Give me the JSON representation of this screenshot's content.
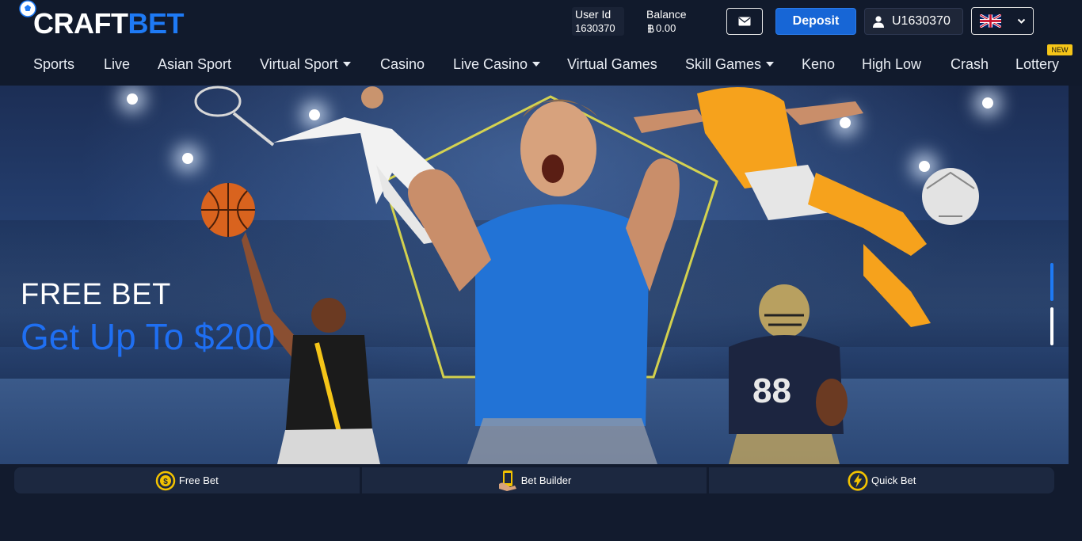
{
  "header": {
    "logo": {
      "part1": "CRAFT",
      "part2": "BET"
    },
    "user_id": {
      "label": "User Id",
      "value": "1630370"
    },
    "balance": {
      "label": "Balance",
      "value": "0.00",
      "currency_icon": "bitcoin-icon"
    },
    "deposit_label": "Deposit",
    "account_label": "U1630370",
    "language_flag": "uk-flag-icon"
  },
  "nav": {
    "items": [
      {
        "label": "Sports"
      },
      {
        "label": "Live"
      },
      {
        "label": "Asian Sport"
      },
      {
        "label": "Virtual Sport"
      },
      {
        "label": "Casino"
      },
      {
        "label": "Live Casino"
      },
      {
        "label": "Virtual Games"
      },
      {
        "label": "Skill Games"
      },
      {
        "label": "Keno"
      },
      {
        "label": "High Low"
      },
      {
        "label": "Crash"
      },
      {
        "label": "Lottery"
      }
    ],
    "new_badge": "NEW"
  },
  "banner": {
    "headline": "FREE BET",
    "subline": "Get Up To $200"
  },
  "quickbar": {
    "items": [
      {
        "label": "Free Bet",
        "icon": "coin-cycle-icon"
      },
      {
        "label": "Bet Builder",
        "icon": "phone-hand-icon"
      },
      {
        "label": "Quick Bet",
        "icon": "lightning-icon"
      }
    ]
  },
  "colors": {
    "background": "#121b2e",
    "accent": "#1e7af5",
    "deposit": "#1766d6",
    "badge": "#f5c518",
    "icon_gold": "#f2c200"
  }
}
